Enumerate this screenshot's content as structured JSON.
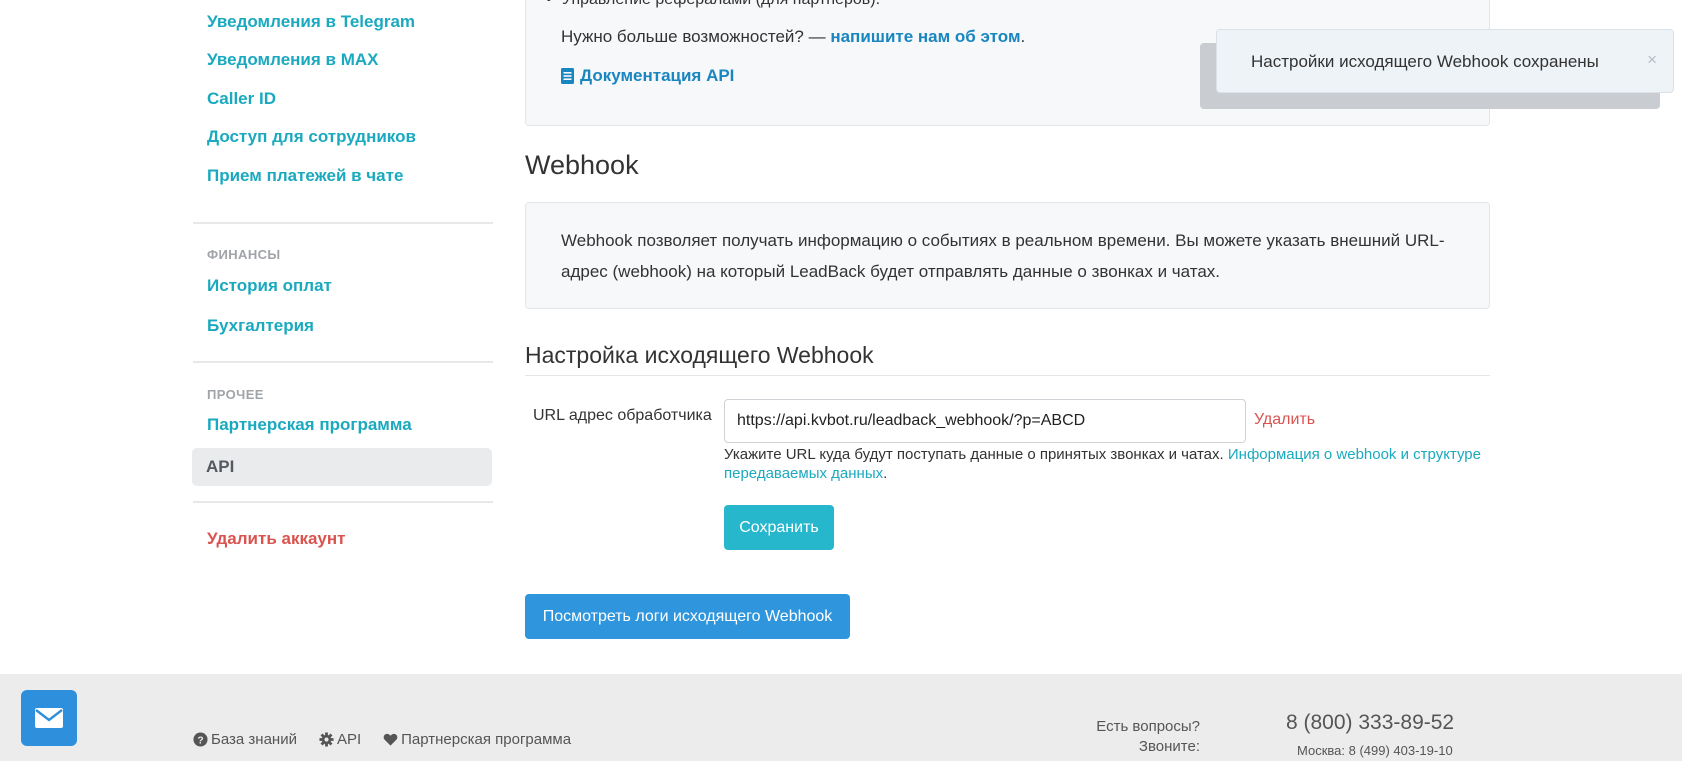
{
  "sidebar": {
    "links_top": [
      {
        "label": "Уведомления в Telegram"
      },
      {
        "label": "Уведомления в MAX"
      },
      {
        "label": "Caller ID"
      },
      {
        "label": "Доступ для сотрудников"
      },
      {
        "label": "Прием платежей в чате"
      }
    ],
    "finance_title": "ФИНАНСЫ",
    "finance_links": [
      {
        "label": "История оплат"
      },
      {
        "label": "Бухгалтерия"
      }
    ],
    "other_title": "ПРОЧЕЕ",
    "partner_label": "Партнерская программа",
    "api_label": "API",
    "delete_account_label": "Удалить аккаунт"
  },
  "top_panel": {
    "bullet": "Управление рефералами (для партнеров).",
    "more_text": "Нужно больше возможностей? — ",
    "more_link": "напишите нам об этом",
    "more_suffix": ".",
    "doc_link": "Документация API"
  },
  "webhook": {
    "title": "Webhook",
    "description": "Webhook позволяет получать информацию о событиях в реальном времени. Вы можете указать внешний URL-адрес (webhook) на который LeadBack будет отправлять данные о звонках и чатах."
  },
  "settings": {
    "title": "Настройка исходящего Webhook",
    "url_label": "URL адрес обработчика",
    "url_value": "https://api.kvbot.ru/leadback_webhook/?p=ABCD",
    "delete_label": "Удалить",
    "help_text": "Укажите URL куда будут поступать данные о принятых звонках и чатах. ",
    "help_link": "Информация о webhook и структуре передаваемых данных",
    "help_suffix": ".",
    "save_label": "Сохранить",
    "logs_label": "Посмотреть логи исходящего Webhook"
  },
  "toast": {
    "message": "Настройки исходящего Webhook сохранены",
    "close": "×"
  },
  "footer": {
    "links": [
      {
        "icon": "question-circle-icon",
        "label": "База знаний"
      },
      {
        "icon": "gear-icon",
        "label": "API"
      },
      {
        "icon": "heart-icon",
        "label": "Партнерская программа"
      }
    ],
    "question_line1": "Есть вопросы?",
    "question_line2": "Звоните:",
    "phone": "8 (800) 333-89-52",
    "phone_moscow": "Москва: 8 (499) 403-19-10"
  },
  "colors": {
    "accent_teal": "#1ba9bf",
    "link_blue": "#1a86c0",
    "danger": "#d9534f",
    "save_button": "#27b7cd",
    "logs_button": "#2f96dd"
  }
}
